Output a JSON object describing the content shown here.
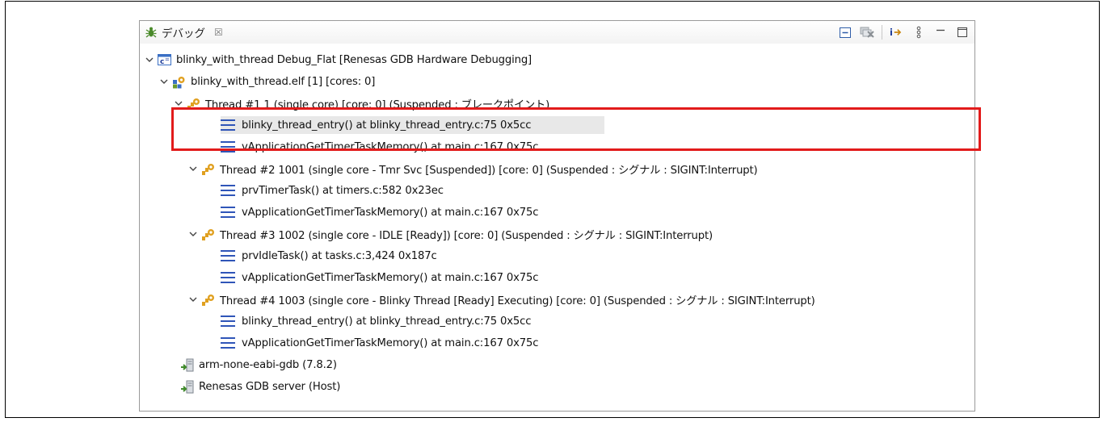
{
  "tab": {
    "title": "デバッグ",
    "close_glyph": "☒"
  },
  "toolbar": [
    "collapse-all-icon",
    "remove-terminated-icon",
    "step-into-icon",
    "view-menu-icon",
    "minimize-icon",
    "maximize-icon"
  ],
  "tree": {
    "launch": {
      "label": "blinky_with_thread Debug_Flat [Renesas GDB Hardware Debugging]"
    },
    "process": {
      "label": "blinky_with_thread.elf [1] [cores: 0]"
    },
    "threads": [
      {
        "label": "Thread #1 1 (single core) [core: 0] (Suspended : ブレークポイント)",
        "frames": [
          "blinky_thread_entry() at blinky_thread_entry.c:75 0x5cc",
          "vApplicationGetTimerTaskMemory() at main.c:167 0x75c"
        ]
      },
      {
        "label": "Thread #2 1001 (single core - Tmr Svc [Suspended]) [core: 0] (Suspended : シグナル : SIGINT:Interrupt)",
        "frames": [
          "prvTimerTask() at timers.c:582 0x23ec",
          "vApplicationGetTimerTaskMemory() at main.c:167 0x75c"
        ]
      },
      {
        "label": "Thread #3 1002 (single core - IDLE [Ready]) [core: 0] (Suspended : シグナル : SIGINT:Interrupt)",
        "frames": [
          "prvIdleTask() at tasks.c:3,424 0x187c",
          "vApplicationGetTimerTaskMemory() at main.c:167 0x75c"
        ]
      },
      {
        "label": "Thread #4 1003 (single core - Blinky Thread [Ready] Executing) [core: 0] (Suspended : シグナル : SIGINT:Interrupt)",
        "frames": [
          "blinky_thread_entry() at blinky_thread_entry.c:75 0x5cc",
          "vApplicationGetTimerTaskMemory() at main.c:167 0x75c"
        ]
      }
    ],
    "gdb": {
      "label": "arm-none-eabi-gdb (7.8.2)"
    },
    "server": {
      "label": "Renesas GDB server (Host)"
    }
  },
  "highlight_color": "#e21b1b"
}
